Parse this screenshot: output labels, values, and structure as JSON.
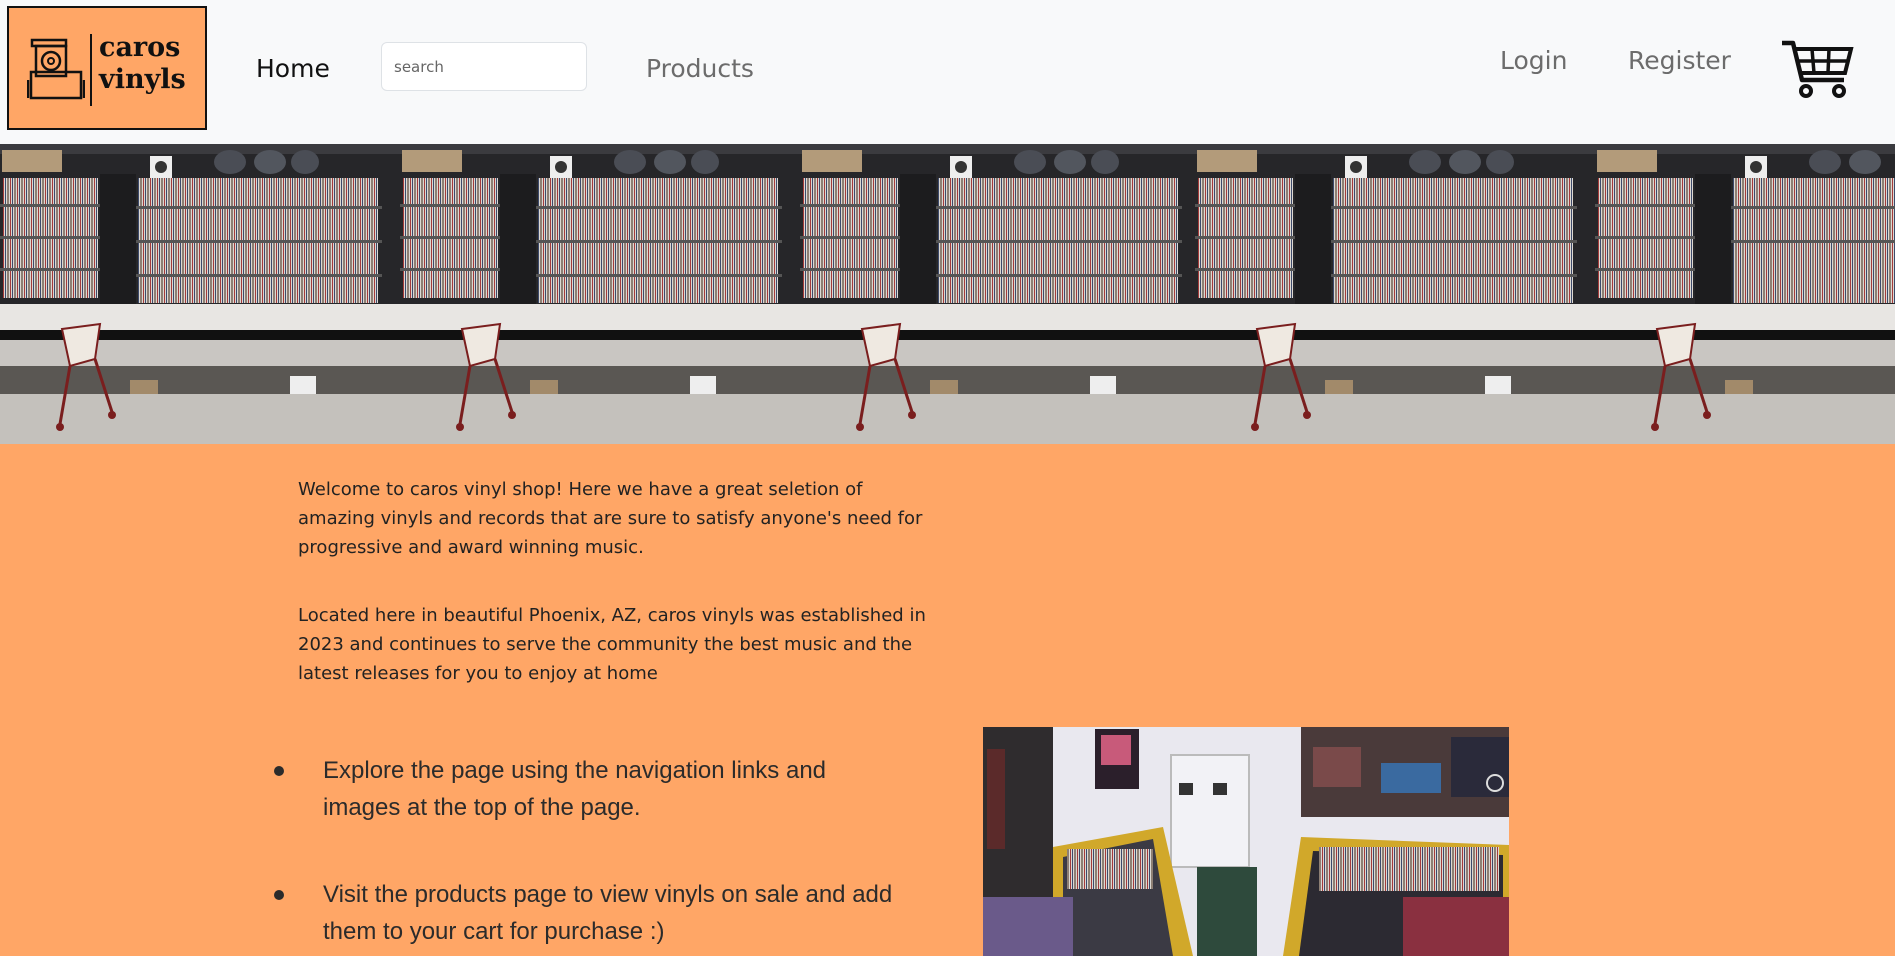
{
  "brand": {
    "name_line1": "caros",
    "name_line2": "vinyls",
    "logo_icon": "vinyl-crate-icon",
    "accent_color": "#ffa666"
  },
  "nav": {
    "home": "Home",
    "search_placeholder": "search",
    "products": "Products",
    "login": "Login",
    "register": "Register",
    "cart_icon": "shopping-cart-icon"
  },
  "banner": {
    "image_subject": "record-shelves-banner",
    "tile_count": 5
  },
  "content": {
    "intro_paragraph_1": "Welcome to caros vinyl shop! Here we have a great seletion of amazing vinyls and records that are sure to satisfy anyone's need for progressive and award winning music.",
    "intro_paragraph_2": "Located here in beautiful Phoenix, AZ, caros vinyls was established in 2023 and continues to serve the community the best music and the latest releases for you to enjoy at home",
    "features": [
      "Explore the page using the navigation links and images at the top of the page.",
      "Visit the products page to view vinyls on sale and add them to your cart for purchase :)"
    ],
    "store_image_subject": "record-store-interior-photo"
  }
}
